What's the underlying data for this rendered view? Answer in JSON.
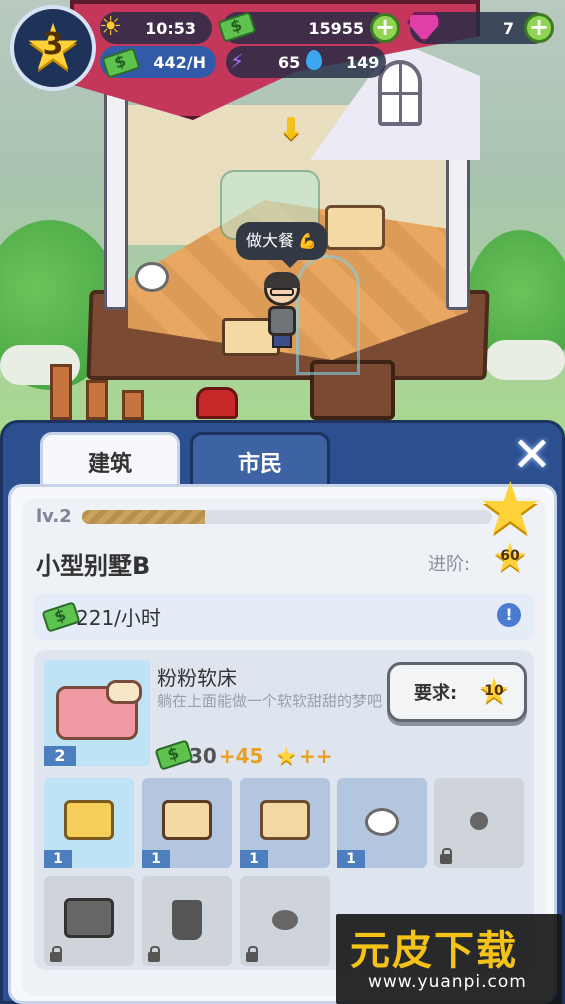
{
  "hud": {
    "level": "3",
    "time": "10:53",
    "income_rate": "442/H",
    "cash": "15955",
    "gems": "7",
    "energy": "65",
    "water": "149",
    "icons": [
      "sun-icon",
      "cash-icon",
      "gem-icon",
      "bolt-icon",
      "drop-icon",
      "plus-icon"
    ]
  },
  "scene": {
    "speech_bubble": "做大餐"
  },
  "tabs": [
    {
      "label": "建筑",
      "active": true
    },
    {
      "label": "市民",
      "active": false
    }
  ],
  "building": {
    "level_label": "lv.2",
    "level_progress": 0.3,
    "name": "小型别墅B",
    "upgrade_label": "进阶:",
    "upgrade_stars": "60",
    "income": "221/小时"
  },
  "item": {
    "title": "粉粉软床",
    "description": "躺在上面能做一个软软甜甜的梦吧",
    "count": "2",
    "base_income": "30",
    "bonus_income": "+45",
    "star_bonus": "++",
    "requirement_label": "要求:",
    "requirement_stars": "10"
  },
  "slots": [
    {
      "name": "bed",
      "count": "1",
      "state": "active"
    },
    {
      "name": "table",
      "count": "1",
      "state": "owned"
    },
    {
      "name": "desk",
      "count": "1",
      "state": "owned"
    },
    {
      "name": "toilet",
      "count": "1",
      "state": "owned"
    },
    {
      "name": "lamp",
      "count": "",
      "state": "locked"
    },
    {
      "name": "tv",
      "count": "",
      "state": "locked"
    },
    {
      "name": "plant",
      "count": "",
      "state": "locked"
    },
    {
      "name": "stool",
      "count": "",
      "state": "locked"
    }
  ],
  "watermark": {
    "logo": "元皮下载",
    "url": "www.yuanpi.com"
  }
}
